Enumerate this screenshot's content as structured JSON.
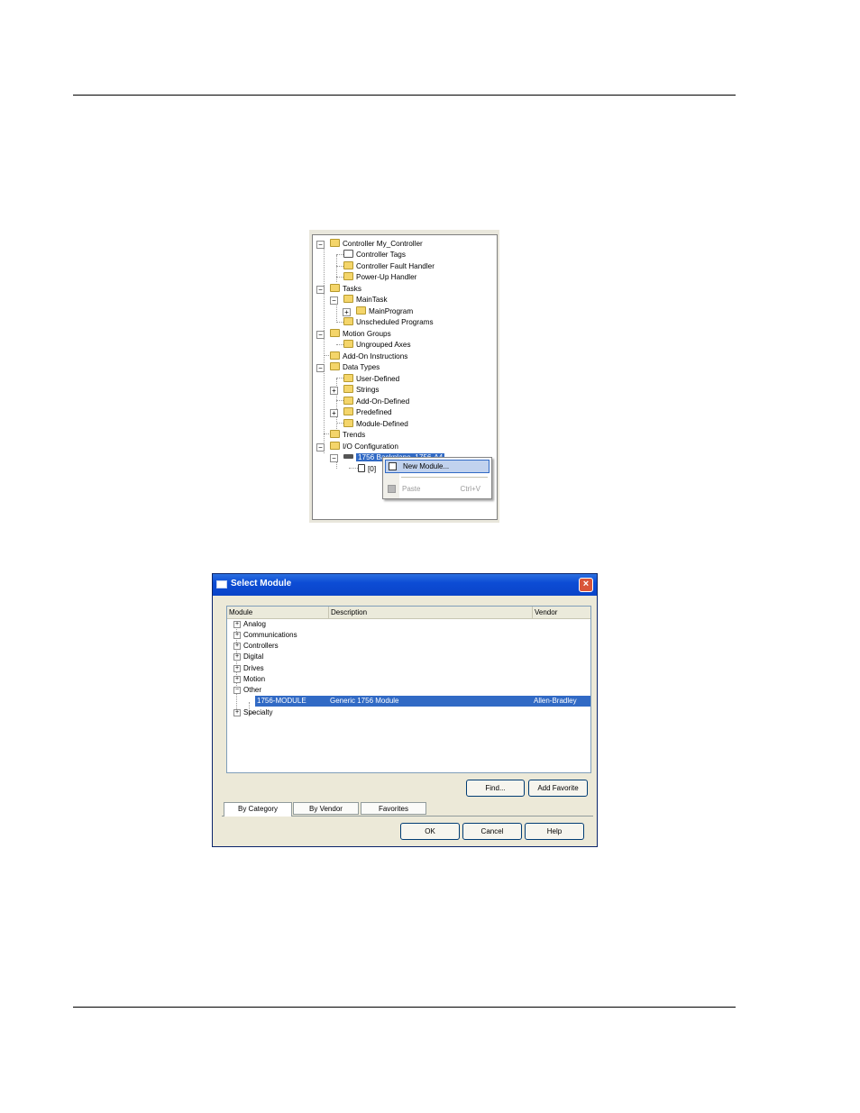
{
  "tree": {
    "nodes": [
      {
        "label": "Controller My_Controller",
        "expander": "−"
      },
      {
        "label": "Controller Tags"
      },
      {
        "label": "Controller Fault Handler"
      },
      {
        "label": "Power-Up Handler"
      },
      {
        "label": "Tasks",
        "expander": "−"
      },
      {
        "label": "MainTask",
        "expander": "−"
      },
      {
        "label": "MainProgram",
        "expander": "+"
      },
      {
        "label": "Unscheduled Programs"
      },
      {
        "label": "Motion Groups",
        "expander": "−"
      },
      {
        "label": "Ungrouped Axes"
      },
      {
        "label": "Add-On Instructions"
      },
      {
        "label": "Data Types",
        "expander": "−"
      },
      {
        "label": "User-Defined"
      },
      {
        "label": "Strings",
        "expander": "+"
      },
      {
        "label": "Add-On-Defined"
      },
      {
        "label": "Predefined",
        "expander": "+"
      },
      {
        "label": "Module-Defined"
      },
      {
        "label": "Trends"
      },
      {
        "label": "I/O Configuration",
        "expander": "−"
      },
      {
        "label": "1756 Backplane, 1756-A4",
        "expander": "−"
      },
      {
        "label": "[0]"
      }
    ]
  },
  "context_menu": {
    "new_module": "New Module...",
    "paste": "Paste",
    "paste_shortcut": "Ctrl+V"
  },
  "dialog": {
    "title": "Select Module",
    "close_glyph": "×",
    "columns": [
      "Module",
      "Description",
      "Vendor"
    ],
    "categories": [
      {
        "label": "Analog",
        "expander": "+"
      },
      {
        "label": "Communications",
        "expander": "+"
      },
      {
        "label": "Controllers",
        "expander": "+"
      },
      {
        "label": "Digital",
        "expander": "+"
      },
      {
        "label": "Drives",
        "expander": "+"
      },
      {
        "label": "Motion",
        "expander": "+"
      },
      {
        "label": "Other",
        "expander": "−"
      },
      {
        "label": "Specialty",
        "expander": "+"
      }
    ],
    "selected_row": {
      "module": "1756-MODULE",
      "description": "Generic 1756 Module",
      "vendor": "Allen-Bradley"
    },
    "find_button": "Find...",
    "add_favorite_button": "Add Favorite",
    "tabs": [
      "By Category",
      "By Vendor",
      "Favorites"
    ],
    "ok_button": "OK",
    "cancel_button": "Cancel",
    "help_button": "Help"
  },
  "colors": {
    "selection": "#316ac5",
    "titlebar": "#0c4cd5",
    "folder": "#f4d56a"
  }
}
